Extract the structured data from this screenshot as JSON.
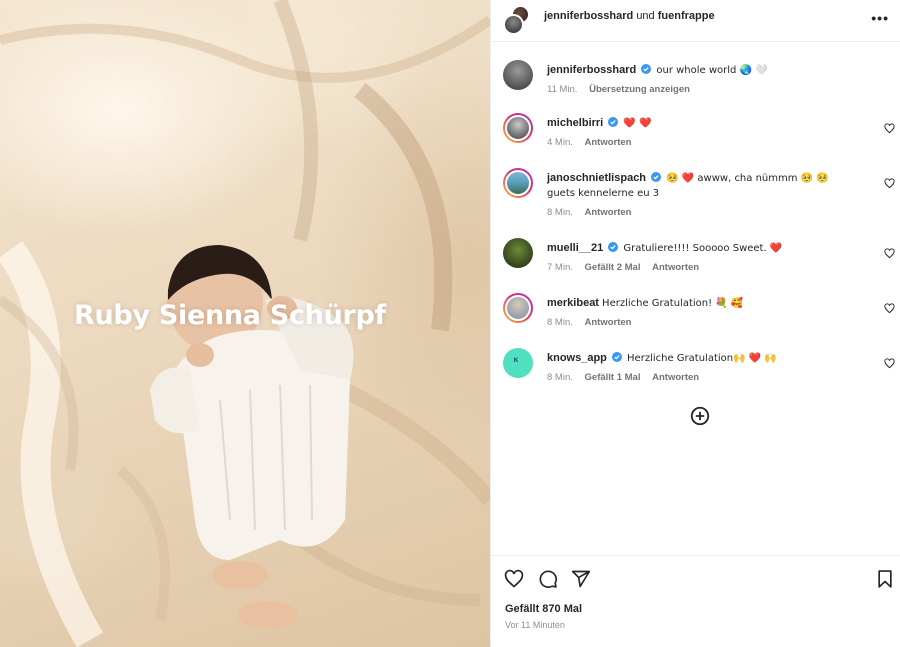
{
  "photo": {
    "overlay_text": "Ruby Sienna Schürpf"
  },
  "header": {
    "user1": "jenniferbosshard",
    "separator": "und",
    "user2": "fuenfrappe",
    "more_icon": "more-horizontal-icon"
  },
  "caption": {
    "username": "jenniferbosshard",
    "text": "our whole world 🌏 🤍",
    "time": "11 Min.",
    "translate": "Übersetzung anzeigen"
  },
  "comments": [
    {
      "username": "michelbirri",
      "verified": true,
      "text": "❤️ ❤️",
      "time": "4 Min.",
      "likes": "",
      "reply": "Antworten"
    },
    {
      "username": "janoschnietlispach",
      "verified": true,
      "text": "🥺 ❤️ awww, cha nümmm 🥺 🥺 guets kennelerne eu 3",
      "time": "8 Min.",
      "likes": "",
      "reply": "Antworten"
    },
    {
      "username": "muelli__21",
      "verified": true,
      "text": "Gratuliere!!!! Sooooo Sweet. ❤️",
      "time": "7 Min.",
      "likes": "Gefällt 2 Mal",
      "reply": "Antworten"
    },
    {
      "username": "merkibeat",
      "verified": false,
      "text": "Herzliche Gratulation! 💐 🥰",
      "time": "8 Min.",
      "likes": "",
      "reply": "Antworten"
    },
    {
      "username": "knows_app",
      "verified": true,
      "text": "Herzliche Gratulation🙌 ❤️ 🙌",
      "time": "8 Min.",
      "likes": "Gefällt 1 Mal",
      "reply": "Antworten"
    }
  ],
  "footer": {
    "likes": "Gefällt 870 Mal",
    "time": "Vor 11 Minuten"
  },
  "colors": {
    "verified": "#3897f0",
    "heart": "#ed4956",
    "muted": "#8e8e8e"
  }
}
